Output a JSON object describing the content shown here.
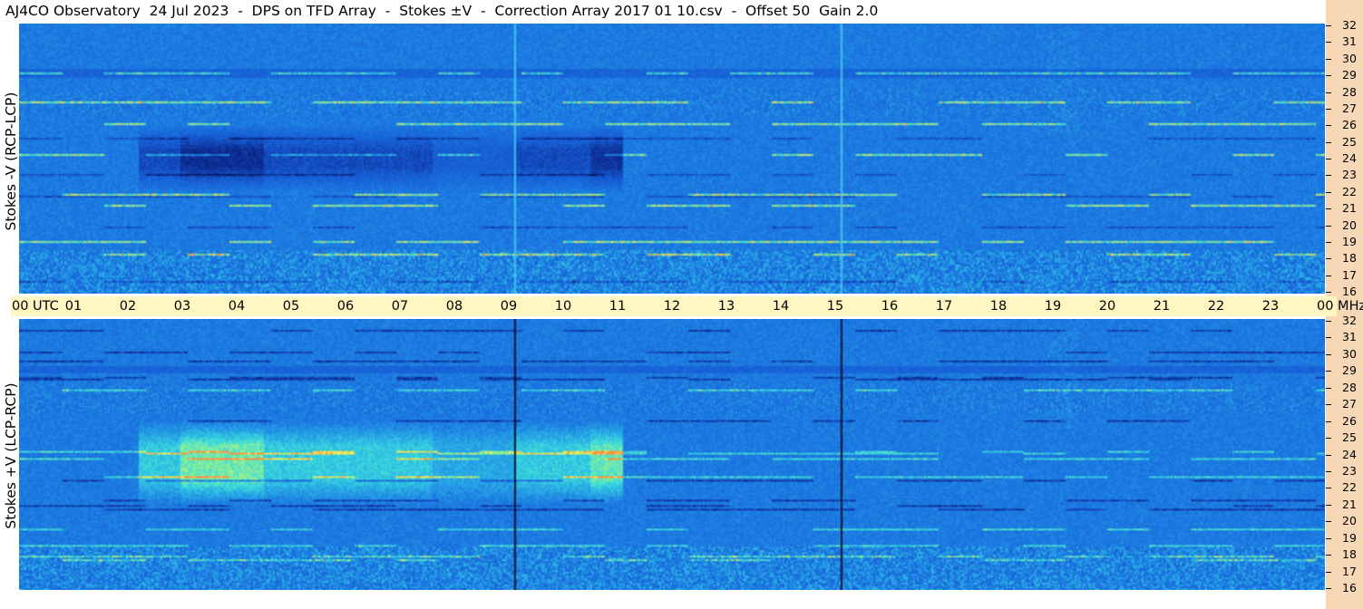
{
  "header": {
    "title": "AJ4CO Observatory  24 Jul 2023  -  DPS on TFD Array  -  Stokes ±V  -  Correction Array 2017 01 10.csv  -  Offset 50  Gain 2.0"
  },
  "chart_data": [
    {
      "type": "heatmap",
      "panel": "top",
      "ylabel": "Stokes -V (RCP-LCP)",
      "x_ticks": [
        "00 UTC",
        "01",
        "02",
        "03",
        "04",
        "05",
        "06",
        "07",
        "08",
        "09",
        "10",
        "11",
        "12",
        "13",
        "14",
        "15",
        "16",
        "17",
        "18",
        "19",
        "20",
        "21",
        "22",
        "23",
        "00 MHz"
      ],
      "x_range_hours": [
        0,
        24
      ],
      "y_ticks": [
        "32",
        "31",
        "30",
        "29",
        "28",
        "27",
        "26",
        "25",
        "24",
        "23",
        "22",
        "21",
        "20",
        "19",
        "18",
        "17",
        "16"
      ],
      "y_range_mhz": [
        16,
        32
      ],
      "colormap": "spectrogram blue-cyan-yellow",
      "features": {
        "dark_block_hours": [
          2.2,
          11.1
        ],
        "dark_block_mhz": [
          22,
          26
        ],
        "vertical_lines_hours": [
          9.1,
          15.1
        ]
      }
    },
    {
      "type": "heatmap",
      "panel": "bottom",
      "ylabel": "Stokes +V (LCP-RCP)",
      "x_range_hours": [
        0,
        24
      ],
      "y_ticks": [
        "32",
        "31",
        "30",
        "29",
        "28",
        "27",
        "26",
        "25",
        "24",
        "23",
        "22",
        "21",
        "20",
        "19",
        "18",
        "17",
        "16"
      ],
      "y_range_mhz": [
        16,
        32
      ],
      "colormap": "spectrogram blue-cyan-yellow",
      "features": {
        "bright_block_hours": [
          2.2,
          11.1
        ],
        "bright_block_mhz": [
          21,
          26
        ],
        "vertical_lines_hours": [
          9.1,
          15.1
        ]
      }
    }
  ],
  "colors": {
    "background": "#ffffff",
    "time_bar": "#fff7c2",
    "right_strip": "#f6d7b6",
    "base_blue": "#1c64d8"
  }
}
